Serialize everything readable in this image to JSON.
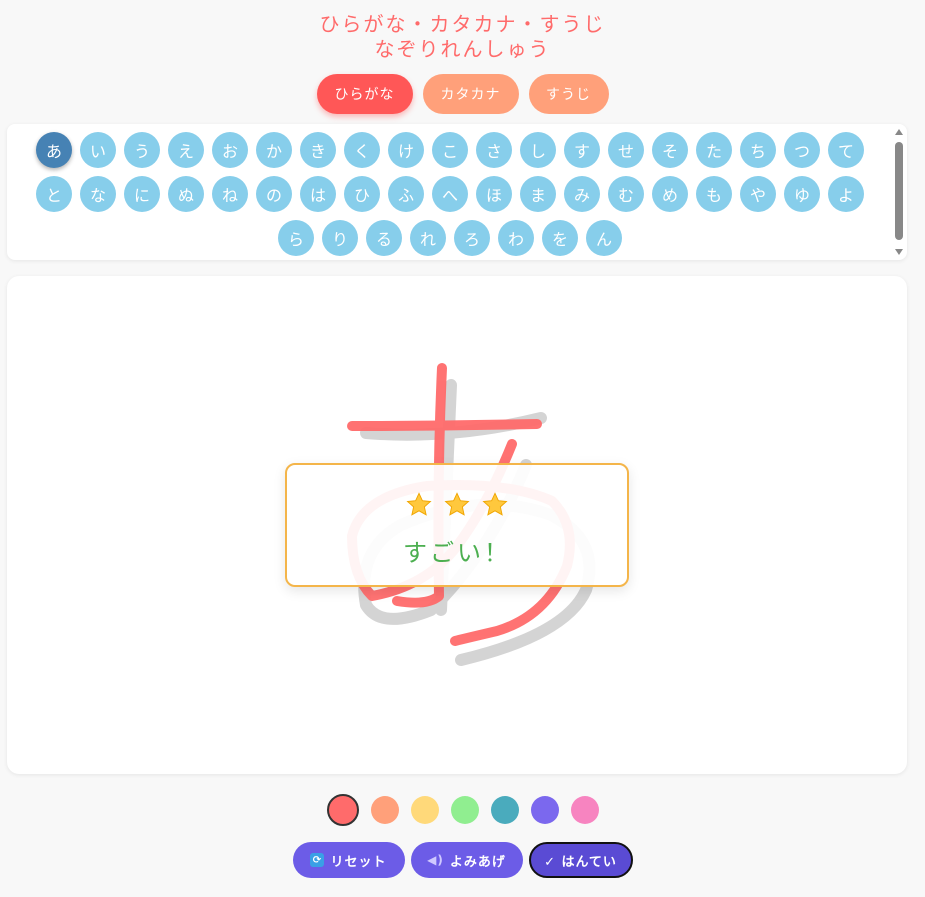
{
  "header": {
    "title_line1": "ひらがな・カタカナ・すうじ",
    "title_line2": "なぞりれんしゅう"
  },
  "tabs": [
    {
      "label": "ひらがな",
      "active": true
    },
    {
      "label": "カタカナ",
      "active": false
    },
    {
      "label": "すうじ",
      "active": false
    }
  ],
  "characters": {
    "row1": [
      "あ",
      "い",
      "う",
      "え",
      "お",
      "か",
      "き",
      "く",
      "け",
      "こ",
      "さ",
      "し",
      "す",
      "せ",
      "そ",
      "た",
      "ち",
      "つ",
      "て"
    ],
    "row2": [
      "と",
      "な",
      "に",
      "ぬ",
      "ね",
      "の",
      "は",
      "ひ",
      "ふ",
      "へ",
      "ほ",
      "ま",
      "み",
      "む",
      "め",
      "も",
      "や",
      "ゆ",
      "よ"
    ],
    "row3": [
      "ら",
      "り",
      "る",
      "れ",
      "ろ",
      "わ",
      "を",
      "ん"
    ],
    "selected": "あ"
  },
  "canvas": {
    "guide_character": "あ",
    "stroke_color": "#ff6b6b"
  },
  "result": {
    "stars": 3,
    "message": "すごい！"
  },
  "palette": {
    "colors": [
      "#ff6b6b",
      "#ffa07a",
      "#ffd97a",
      "#90ee90",
      "#4aabbd",
      "#7b68ee",
      "#f784c0"
    ],
    "selected_index": 0
  },
  "actions": {
    "reset_label": "リセット",
    "read_label": "よみあげ",
    "judge_label": "✓ はんてい"
  },
  "icons": {
    "reset": "refresh-icon",
    "read": "speaker-icon",
    "star": "star-icon"
  }
}
